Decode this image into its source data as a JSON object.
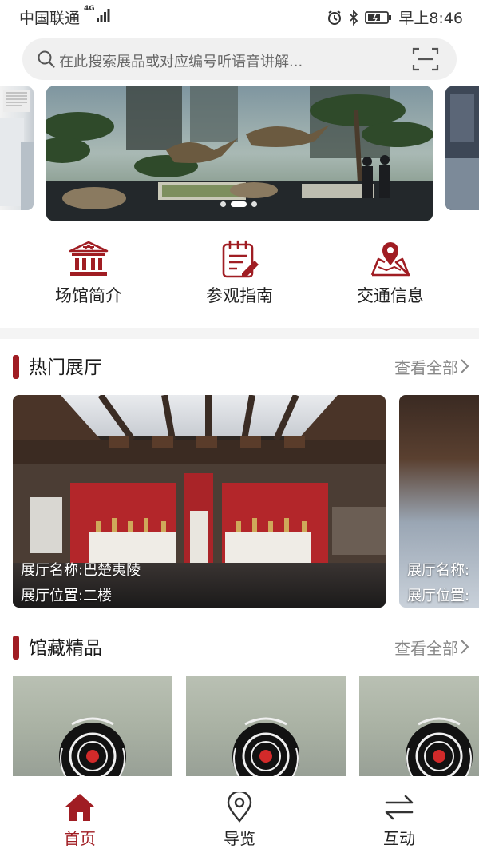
{
  "status_bar": {
    "carrier": "中国联通",
    "network": "4G",
    "time": "早上8:46"
  },
  "search": {
    "placeholder": "在此搜索展品或对应编号听语音讲解..."
  },
  "banner": {
    "slide_count": 3,
    "active_slide": 2
  },
  "quick_entries": [
    {
      "label": "场馆简介",
      "icon": "museum-building-icon"
    },
    {
      "label": "参观指南",
      "icon": "guide-notepad-icon"
    },
    {
      "label": "交通信息",
      "icon": "map-location-icon"
    }
  ],
  "hot_halls": {
    "title": "热门展厅",
    "more": "查看全部",
    "items": [
      {
        "name_line": "展厅名称:巴楚夷陵",
        "location_line": "展厅位置:二楼"
      },
      {
        "name_line": "展厅名称:",
        "location_line": "展厅位置:"
      }
    ]
  },
  "collection": {
    "title": "馆藏精品",
    "more": "查看全部"
  },
  "tabbar": {
    "tabs": [
      {
        "label": "首页",
        "icon": "home-icon",
        "active": true
      },
      {
        "label": "导览",
        "icon": "location-pin-icon",
        "active": false
      },
      {
        "label": "互动",
        "icon": "swap-arrows-icon",
        "active": false
      }
    ]
  },
  "colors": {
    "accent": "#a01d23",
    "background": "#ffffff",
    "muted_text": "#888888"
  }
}
